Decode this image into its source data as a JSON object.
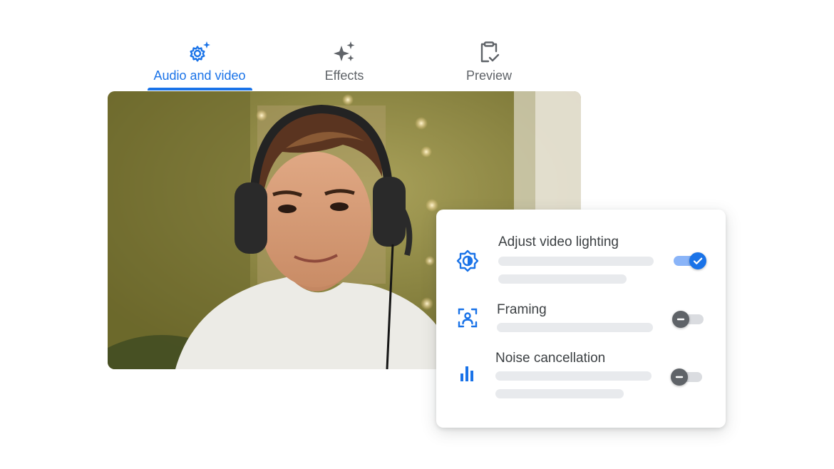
{
  "tabs": [
    {
      "label": "Audio and video",
      "icon": "settings-sparkle-icon",
      "active": true
    },
    {
      "label": "Effects",
      "icon": "sparkles-icon",
      "active": false
    },
    {
      "label": "Preview",
      "icon": "clipboard-check-icon",
      "active": false
    }
  ],
  "video": {
    "subject": "man-with-headset-photo"
  },
  "settings": [
    {
      "title": "Adjust video lighting",
      "icon": "brightness-icon",
      "enabled": true
    },
    {
      "title": "Framing",
      "icon": "framing-icon",
      "enabled": false
    },
    {
      "title": "Noise cancellation",
      "icon": "equalizer-icon",
      "enabled": false
    }
  ],
  "colors": {
    "accent": "#1a73e8",
    "toggle_on_track": "#8ab4f8",
    "placeholder_bar": "#e8eaed",
    "text": "#3c4043"
  }
}
